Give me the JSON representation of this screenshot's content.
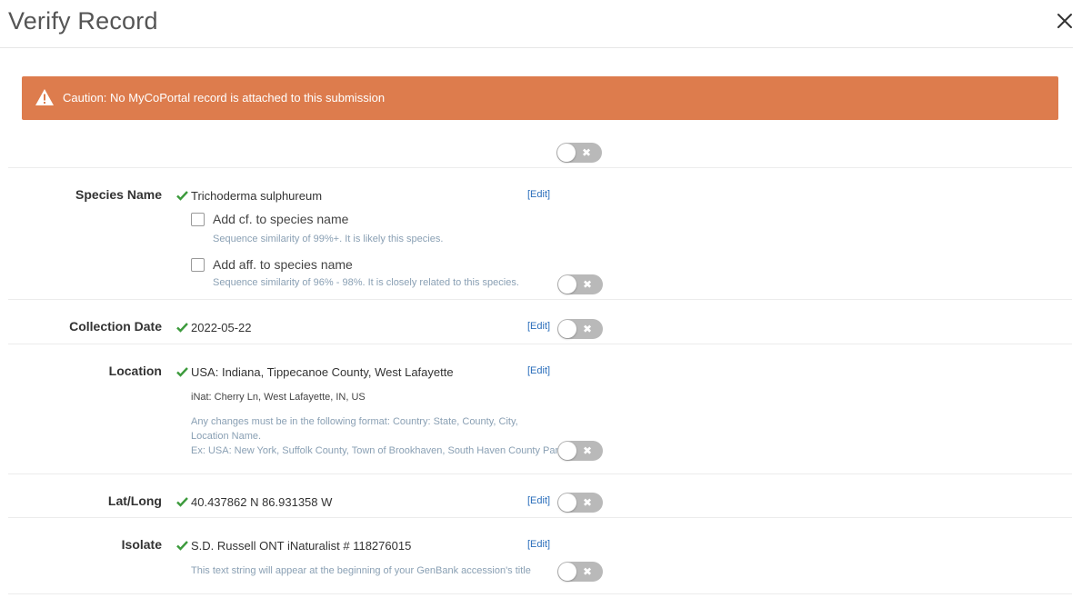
{
  "modal": {
    "title": "Verify Record",
    "close_icon": "close-icon"
  },
  "alert": {
    "icon": "warning-icon",
    "text": "Caution: No MyCoPortal record is attached to this submission",
    "color": "#dd7c4d"
  },
  "toggle_glyph": "✖",
  "edit_label": "[Edit]",
  "species": {
    "label": "Species Name",
    "value": "Trichoderma sulphureum",
    "cf_label": "Add cf. to species name",
    "cf_checked": false,
    "cf_hint": "Sequence similarity of 99%+. It is likely this species.",
    "aff_label": "Add aff. to species name",
    "aff_checked": false,
    "aff_hint": "Sequence similarity of 96% - 98%. It is closely related to this species."
  },
  "collection_date": {
    "label": "Collection Date",
    "value": "2022-05-22"
  },
  "location": {
    "label": "Location",
    "value": "USA: Indiana, Tippecanoe County, West Lafayette",
    "inat": "iNat: Cherry Ln, West Lafayette, IN, US",
    "format_hint_1": "Any changes must be in the following format: Country: State, County, City,",
    "format_hint_2": "Location Name.",
    "format_example": "Ex: USA: New York, Suffolk County, Town of Brookhaven, South Haven County Park"
  },
  "latlong": {
    "label": "Lat/Long",
    "value": "40.437862 N 86.931358 W"
  },
  "isolate": {
    "label": "Isolate",
    "value": "S.D. Russell ONT iNaturalist # 118276015",
    "hint": "This text string will appear at the beginning of your GenBank accession's title"
  },
  "colors": {
    "check": "#3c9a3c",
    "edit_link": "#2a6ebb",
    "toggle_off": "#b9b9b9"
  }
}
